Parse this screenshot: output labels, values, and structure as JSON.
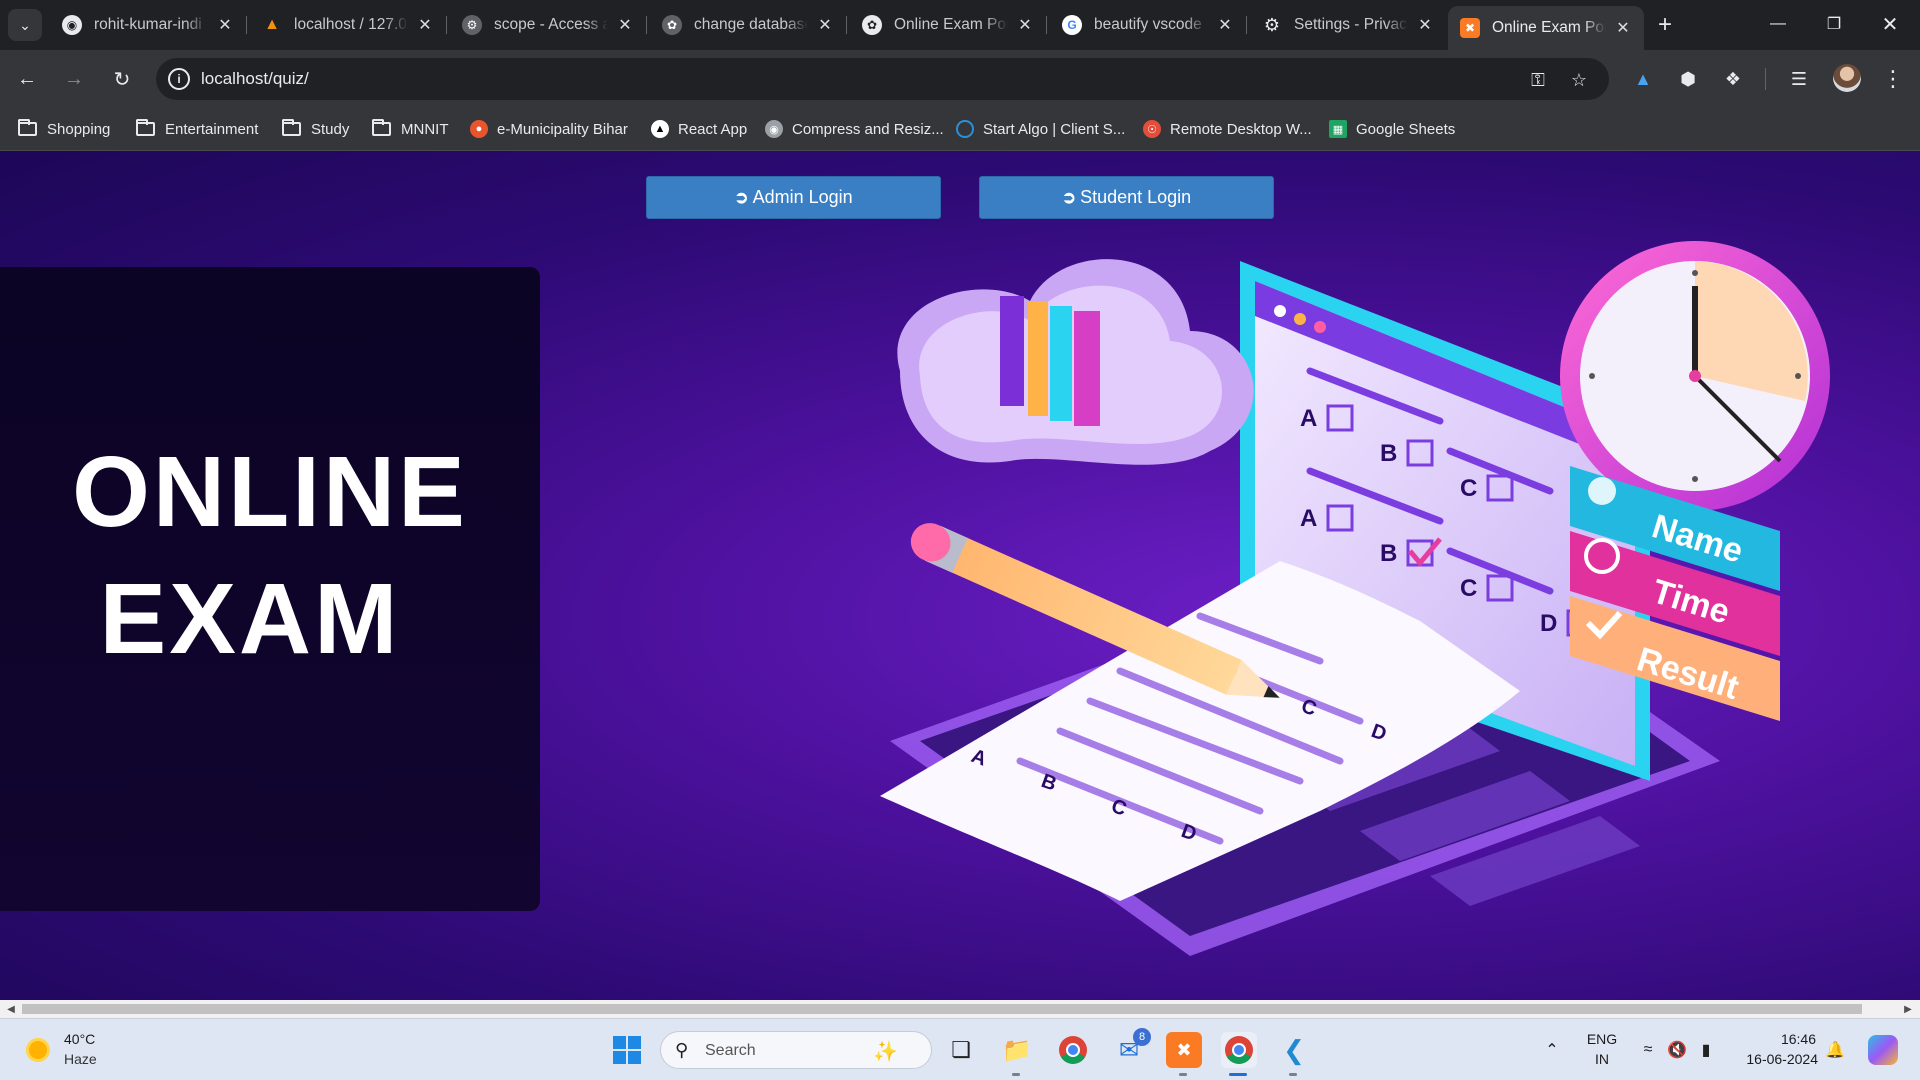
{
  "browser": {
    "tabs": [
      {
        "label": "rohit-kumar-indi",
        "icon": "github-icon",
        "active": false
      },
      {
        "label": "localhost / 127.0",
        "icon": "phpmyadmin-icon",
        "active": false
      },
      {
        "label": "scope - Access a",
        "icon": "stackoverflow-icon",
        "active": false
      },
      {
        "label": "change database",
        "icon": "chatgpt-icon",
        "active": false
      },
      {
        "label": "Online Exam Por",
        "icon": "chatgpt-icon",
        "active": false
      },
      {
        "label": "beautify vscode",
        "icon": "google-icon",
        "active": false
      },
      {
        "label": "Settings - Privac",
        "icon": "settings-gear-icon",
        "active": false
      },
      {
        "label": "Online Exam Por",
        "icon": "xampp-icon",
        "active": true
      }
    ],
    "address": {
      "url": "localhost/quiz/"
    },
    "bookmarks": [
      {
        "label": "Shopping",
        "icon": "folder-icon"
      },
      {
        "label": "Entertainment",
        "icon": "folder-icon"
      },
      {
        "label": "Study",
        "icon": "folder-icon"
      },
      {
        "label": "MNNIT",
        "icon": "folder-icon"
      },
      {
        "label": "e-Municipality Bihar",
        "icon": "municipality-icon"
      },
      {
        "label": "React App",
        "icon": "react-app-icon"
      },
      {
        "label": "Compress and Resiz...",
        "icon": "compress-icon"
      },
      {
        "label": "Start Algo | Client S...",
        "icon": "startalgo-icon"
      },
      {
        "label": "Remote Desktop W...",
        "icon": "remote-desktop-icon"
      },
      {
        "label": "Google Sheets",
        "icon": "google-sheets-icon"
      }
    ]
  },
  "page": {
    "admin_login": "Admin Login",
    "student_login": "Student Login",
    "hero_line1": "ONLINE",
    "hero_line2": "EXAM",
    "illustration": {
      "labels": [
        "Name",
        "Time",
        "Result"
      ],
      "options": [
        "A",
        "B",
        "C",
        "D"
      ]
    }
  },
  "taskbar": {
    "weather": {
      "temp": "40°C",
      "desc": "Haze"
    },
    "search_placeholder": "Search",
    "mail_badge": "8",
    "language": {
      "line1": "ENG",
      "line2": "IN"
    },
    "clock": {
      "time": "16:46",
      "date": "16-06-2024"
    }
  },
  "colors": {
    "button_bg": "#3a7fc4",
    "page_bg": "#4d119e",
    "hero_panel": "#0b0424"
  }
}
